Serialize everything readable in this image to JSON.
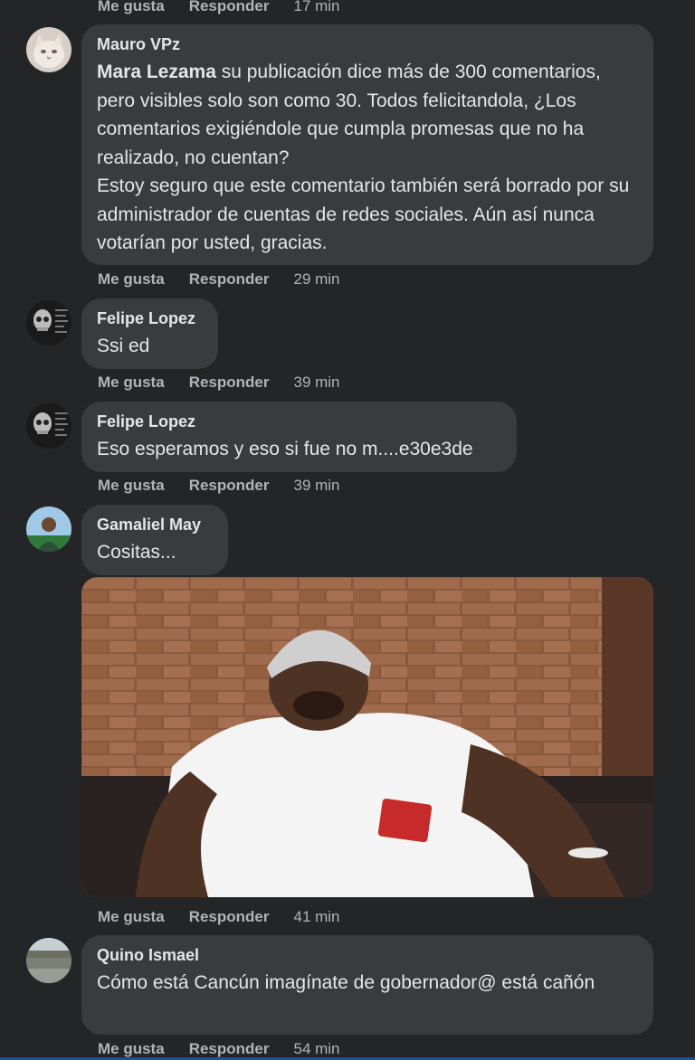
{
  "actions": {
    "like_label": "Me gusta",
    "reply_label": "Responder"
  },
  "top_action_time": "17 min",
  "comments": [
    {
      "author": "Mauro VPz",
      "mention": "Mara Lezama",
      "text": " su publicación dice más de 300 comentarios, pero visibles solo son como 30. Todos felicitandola, ¿Los comentarios exigiéndole que cumpla promesas que no ha realizado, no cuentan?",
      "text2": "Estoy seguro que este comentario también será borrado por su administrador de cuentas de redes sociales. Aún así nunca votarían por usted, gracias.",
      "time": "29 min"
    },
    {
      "author": "Felipe Lopez",
      "text": "Ssi ed",
      "time": "39 min"
    },
    {
      "author": "Felipe Lopez",
      "text": "Eso esperamos y eso si fue no m....e30e3de",
      "time": "39 min"
    },
    {
      "author": "Gamaliel May",
      "text": "Cositas...",
      "time": "41 min"
    },
    {
      "author": "Quino Ismael",
      "text": "Cómo está Cancún imagínate de gobernador@ está cañón",
      "time": "54 min"
    }
  ],
  "colors": {
    "background": "#242526",
    "bubble": "#3a3b3c",
    "text": "#e4e6eb",
    "secondary": "#b0b3b8"
  }
}
